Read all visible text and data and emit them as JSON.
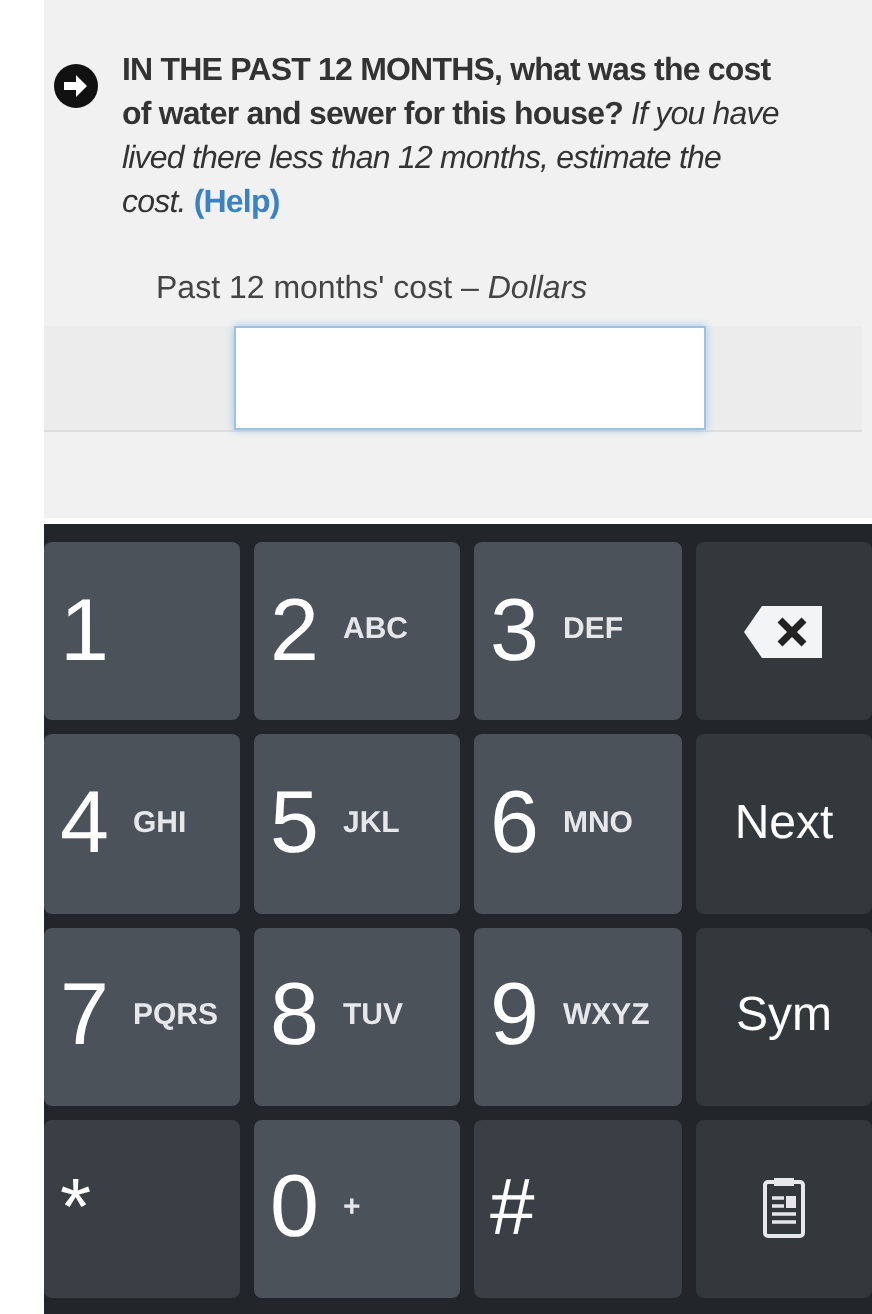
{
  "question": {
    "text": "**IN THE PAST 12 MONTHS, what was the cost of water and sewer for this house?** *If you have lived there less than 12 months, estimate the cost.*",
    "help_link": "(Help)"
  },
  "field": {
    "label": "Past 12 months' cost – *Dollars*"
  },
  "keyboard": [
    {
      "kind": "digit",
      "main": "1"
    },
    {
      "kind": "digit",
      "main": "2",
      "sub": "ABC"
    },
    {
      "kind": "digit",
      "main": "3",
      "sub": "DEF"
    },
    {
      "kind": "delete"
    },
    {
      "kind": "digit",
      "main": "4",
      "sub": "GHI"
    },
    {
      "kind": "digit",
      "main": "5",
      "sub": "JKL"
    },
    {
      "kind": "digit",
      "main": "6",
      "sub": "MNO"
    },
    {
      "kind": "action",
      "main": "Next"
    },
    {
      "kind": "digit",
      "main": "7",
      "sub": "PQRS"
    },
    {
      "kind": "digit",
      "main": "8",
      "sub": "TUV"
    },
    {
      "kind": "digit",
      "main": "9",
      "sub": "WXYZ"
    },
    {
      "kind": "action",
      "main": "Sym"
    },
    {
      "kind": "symbol",
      "main": "*"
    },
    {
      "kind": "digit",
      "main": "0",
      "sub": "+"
    },
    {
      "kind": "symbol",
      "main": "#"
    },
    {
      "kind": "clipboard"
    }
  ]
}
